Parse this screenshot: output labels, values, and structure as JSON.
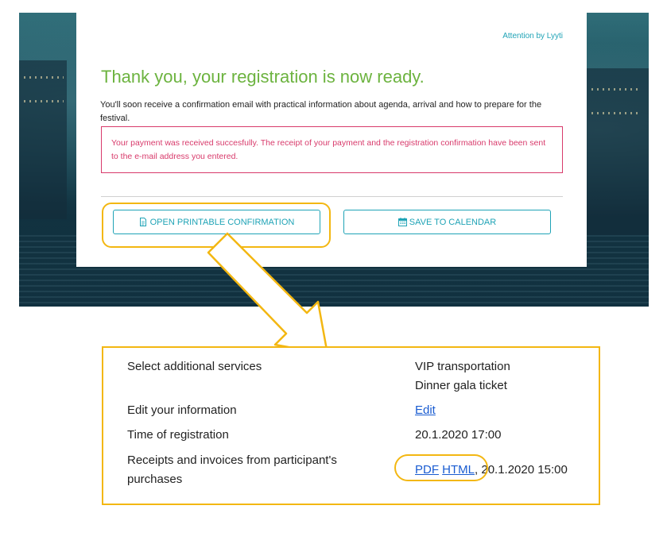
{
  "header": {
    "attention_link": "Attention by Lyyti"
  },
  "confirmation": {
    "title": "Thank you, your registration is now ready.",
    "intro": "You'll soon receive a confirmation email with practical information about agenda, arrival and how to prepare for the festival.",
    "payment_notice": "Your payment was received succesfully. The receipt of your payment and the registration confirmation have been sent to the e-mail address you entered."
  },
  "buttons": {
    "print_label": "OPEN PRINTABLE CONFIRMATION",
    "print_icon": "document-icon",
    "calendar_label": "SAVE TO CALENDAR",
    "calendar_icon": "calendar-icon"
  },
  "details": {
    "additional_services": {
      "label": "Select additional services",
      "values": [
        "VIP transportation",
        "Dinner gala ticket"
      ]
    },
    "edit_info": {
      "label": "Edit your information",
      "link": "Edit"
    },
    "registration_time": {
      "label": "Time of registration",
      "value": "20.1.2020 17:00"
    },
    "receipts": {
      "label_line1": "Receipts and invoices from participant's",
      "label_line2": "purchases",
      "pdf_link": "PDF",
      "html_link": "HTML",
      "separator": ",",
      "date": " 20.1.2020 15:00"
    }
  },
  "colors": {
    "accent": "#1fa3b6",
    "success": "#6cb33f",
    "error": "#d83a6b",
    "highlight": "#f3b712",
    "link": "#1a5cd1"
  }
}
